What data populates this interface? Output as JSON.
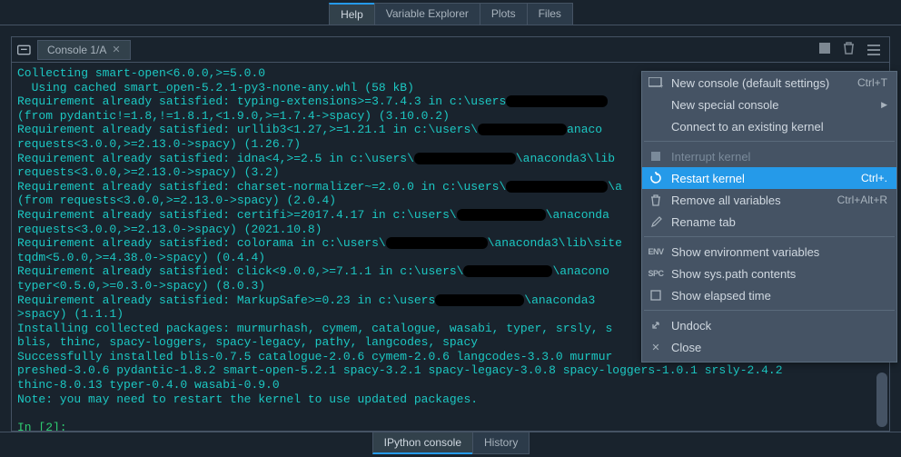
{
  "top_tabs": {
    "help": "Help",
    "var_explorer": "Variable Explorer",
    "plots": "Plots",
    "files": "Files"
  },
  "console_tab": {
    "label": "Console 1/A",
    "close": "✕"
  },
  "output_lines": [
    {
      "t": "Collecting smart-open<6.0.0,>=5.0.0"
    },
    {
      "t": "  Using cached smart_open-5.2.1-py3-none-any.whl (58 kB)"
    },
    {
      "t": "Requirement already satisfied: typing-extensions>=3.7.4.3 in c:\\users",
      "red": 16
    },
    {
      "t": "(from pydantic!=1.8,!=1.8.1,<1.9.0,>=1.7.4->spacy) (3.10.0.2)"
    },
    {
      "t": "Requirement already satisfied: urllib3<1.27,>=1.21.1 in c:\\users\\",
      "red": 14,
      "t2": "anaco"
    },
    {
      "t": "requests<3.0.0,>=2.13.0->spacy) (1.26.7)"
    },
    {
      "t": "Requirement already satisfied: idna<4,>=2.5 in c:\\users\\",
      "red": 16,
      "t2": "\\anaconda3\\lib"
    },
    {
      "t": "requests<3.0.0,>=2.13.0->spacy) (3.2)"
    },
    {
      "t": "Requirement already satisfied: charset-normalizer~=2.0.0 in c:\\users\\",
      "red": 16,
      "t2": "\\a"
    },
    {
      "t": "(from requests<3.0.0,>=2.13.0->spacy) (2.0.4)"
    },
    {
      "t": "Requirement already satisfied: certifi>=2017.4.17 in c:\\users\\",
      "red": 14,
      "t2": "\\anaconda"
    },
    {
      "t": "requests<3.0.0,>=2.13.0->spacy) (2021.10.8)"
    },
    {
      "t": "Requirement already satisfied: colorama in c:\\users\\",
      "red": 16,
      "t2": "\\anaconda3\\lib\\site"
    },
    {
      "t": "tqdm<5.0.0,>=4.38.0->spacy) (0.4.4)"
    },
    {
      "t": "Requirement already satisfied: click<9.0.0,>=7.1.1 in c:\\users\\",
      "red": 14,
      "t2": "\\anacono"
    },
    {
      "t": "typer<0.5.0,>=0.3.0->spacy) (8.0.3)"
    },
    {
      "t": "Requirement already satisfied: MarkupSafe>=0.23 in c:\\users",
      "red": 14,
      "t2": "\\anaconda3"
    },
    {
      "t": ">spacy) (1.1.1)"
    },
    {
      "t": "Installing collected packages: murmurhash, cymem, catalogue, wasabi, typer, srsly, s"
    },
    {
      "t": "blis, thinc, spacy-loggers, spacy-legacy, pathy, langcodes, spacy"
    },
    {
      "t": "Successfully installed blis-0.7.5 catalogue-2.0.6 cymem-2.0.6 langcodes-3.3.0 murmur"
    },
    {
      "t": "preshed-3.0.6 pydantic-1.8.2 smart-open-5.2.1 spacy-3.2.1 spacy-legacy-3.0.8 spacy-loggers-1.0.1 srsly-2.4.2"
    },
    {
      "t": "thinc-8.0.13 typer-0.4.0 wasabi-0.9.0"
    },
    {
      "t": "Note: you may need to restart the kernel to use updated packages."
    }
  ],
  "prompt": "In [2]:",
  "menu": {
    "new_console": "New console (default settings)",
    "new_console_sc": "Ctrl+T",
    "new_special": "New special console",
    "connect": "Connect to an existing kernel",
    "interrupt": "Interrupt kernel",
    "restart": "Restart kernel",
    "restart_sc": "Ctrl+.",
    "remove_vars": "Remove all variables",
    "remove_vars_sc": "Ctrl+Alt+R",
    "rename": "Rename tab",
    "show_env": "Show environment variables",
    "show_sys": "Show sys.path contents",
    "show_elapsed": "Show elapsed time",
    "undock": "Undock",
    "close": "Close"
  },
  "bottom_tabs": {
    "ipython": "IPython console",
    "history": "History"
  }
}
